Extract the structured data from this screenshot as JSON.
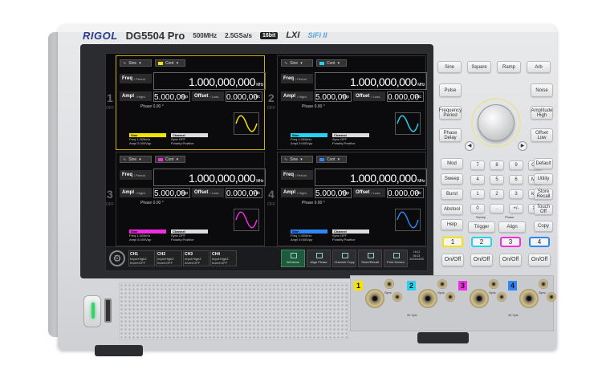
{
  "brand": {
    "logo": "RIGOL",
    "model": "DG5504 Pro",
    "bandwidth": "500MHz",
    "sample_rate": "2.5GSa/s",
    "bits": "16bit",
    "lxi": "LXI",
    "sifi": "SiFi II"
  },
  "channels": [
    {
      "num": "1",
      "off": "OFF",
      "wave": "Sine",
      "mode": "Cont",
      "freq_label": "Freq",
      "freq_alt": "/ Period",
      "freq": "1.000,000,000",
      "freq_unit": "MHz",
      "ampl_label": "Ampl",
      "ampl_alt": "/ HighL",
      "ampl": "5.000,00",
      "ampl_unit": "Vpp",
      "offset_label": "Offset",
      "offset_alt": "/ LowL",
      "offset": "0.000,00",
      "offset_unit": "Vdc",
      "phase_label": "Phase",
      "phase": "0.00 °",
      "info_tag": "Sine",
      "info_freq": "Freq 1.000kHz",
      "info_ampl": "Ampl 5.000Vpp",
      "chan_tag": "Channel",
      "chan_sync": "Sync OFF",
      "chan_pol": "Polarity:Positive",
      "color": "#f5e400",
      "wave_color": "#f5e400"
    },
    {
      "num": "2",
      "off": "OFF",
      "wave": "Sine",
      "mode": "Cont",
      "freq_label": "Freq",
      "freq_alt": "/ Period",
      "freq": "1.000,000,000",
      "freq_unit": "MHz",
      "ampl_label": "Ampl",
      "ampl_alt": "/ HighL",
      "ampl": "5.000,00",
      "ampl_unit": "Vpp",
      "offset_label": "Offset",
      "offset_alt": "/ LowL",
      "offset": "0.000,00",
      "offset_unit": "Vdc",
      "phase_label": "Phase",
      "phase": "0.00 °",
      "info_tag": "Sine",
      "info_freq": "Freq 1.000kHz",
      "info_ampl": "Ampl 5.000Vpp",
      "chan_tag": "Channel",
      "chan_sync": "Sync OFF",
      "chan_pol": "Polarity:Positive",
      "color": "#25d2f0",
      "wave_color": "#25d2f0"
    },
    {
      "num": "3",
      "off": "OFF",
      "wave": "Sine",
      "mode": "Cont",
      "freq_label": "Freq",
      "freq_alt": "/ Period",
      "freq": "1.000,000,000",
      "freq_unit": "MHz",
      "ampl_label": "Ampl",
      "ampl_alt": "/ HighL",
      "ampl": "5.000,00",
      "ampl_unit": "Vpp",
      "offset_label": "Offset",
      "offset_alt": "/ LowL",
      "offset": "0.000,00",
      "offset_unit": "Vdc",
      "phase_label": "Phase",
      "phase": "0.00 °",
      "info_tag": "Sine",
      "info_freq": "Freq 1.000kHz",
      "info_ampl": "Ampl 5.000Vpp",
      "chan_tag": "Channel",
      "chan_sync": "Sync OFF",
      "chan_pol": "Polarity:Positive",
      "color": "#ee2ee0",
      "wave_color": "#ee2ee0"
    },
    {
      "num": "4",
      "off": "OFF",
      "wave": "Sine",
      "mode": "Cont",
      "freq_label": "Freq",
      "freq_alt": "/ Period",
      "freq": "1.000,000,000",
      "freq_unit": "MHz",
      "ampl_label": "Ampl",
      "ampl_alt": "/ HighL",
      "ampl": "5.000,00",
      "ampl_unit": "Vpp",
      "offset_label": "Offset",
      "offset_alt": "/ LowL",
      "offset": "0.000,00",
      "offset_unit": "Vdc",
      "phase_label": "Phase",
      "phase": "0.00 °",
      "info_tag": "Sine",
      "info_freq": "Freq 1.000kHz",
      "info_ampl": "Ampl 5.000Vpp",
      "chan_tag": "Channel",
      "chan_sync": "Sync OFF",
      "chan_pol": "Polarity:Positive",
      "color": "#2f86f5",
      "wave_color": "#2f86f5"
    }
  ],
  "status": {
    "tabs": [
      {
        "name": "CH1",
        "l1": "Impd:HighZ",
        "l2": "Invert:OFF"
      },
      {
        "name": "CH2",
        "l1": "Impd:HighZ",
        "l2": "Invert:OFF"
      },
      {
        "name": "CH3",
        "l1": "Impd:HighZ",
        "l2": "Invert:OFF"
      },
      {
        "name": "CH4",
        "l1": "Impd:HighZ",
        "l2": "Invert:OFF"
      }
    ],
    "buttons": [
      "Windows",
      "Align Phase",
      "Channel Copy",
      "Store/Recall",
      "Print Screen"
    ],
    "clock": {
      "l1": "16:11",
      "l2": "06:23",
      "l3": "2024/04/03"
    }
  },
  "panel": {
    "waves": [
      "Sine",
      "Square",
      "Ramp",
      "Arb"
    ],
    "left": [
      "Pulse",
      "Frequency Period",
      "Phase Delay"
    ],
    "right": [
      "Noise",
      "Amplitude High",
      "Offset Low"
    ],
    "mod": [
      "Mod",
      "Sweep",
      "Burst",
      "Abstool",
      "Help"
    ],
    "digits": [
      [
        "7",
        "8",
        "9",
        "G/n"
      ],
      [
        "4",
        "5",
        "6",
        "M/μ"
      ],
      [
        "1",
        "2",
        "3",
        "k/m"
      ],
      [
        "0",
        ".",
        "+/-",
        "X1"
      ]
    ],
    "side": [
      "Default",
      "Utility",
      "Store Recall",
      "Touch Off"
    ],
    "copy": "Copy",
    "trigger_label": "Sweep",
    "trigger": "Trigger",
    "align_label": "Phase",
    "align": "Align",
    "ch_keys": [
      "1",
      "2",
      "3",
      "4"
    ],
    "onoff": "On/Off"
  },
  "outputs": {
    "labels": [
      "1",
      "2",
      "3",
      "4"
    ],
    "volt": "42 Vpk",
    "sync": "Sync",
    "colors": [
      "#f5e400",
      "#25d2f0",
      "#ee2ee0",
      "#2f86f5"
    ]
  }
}
